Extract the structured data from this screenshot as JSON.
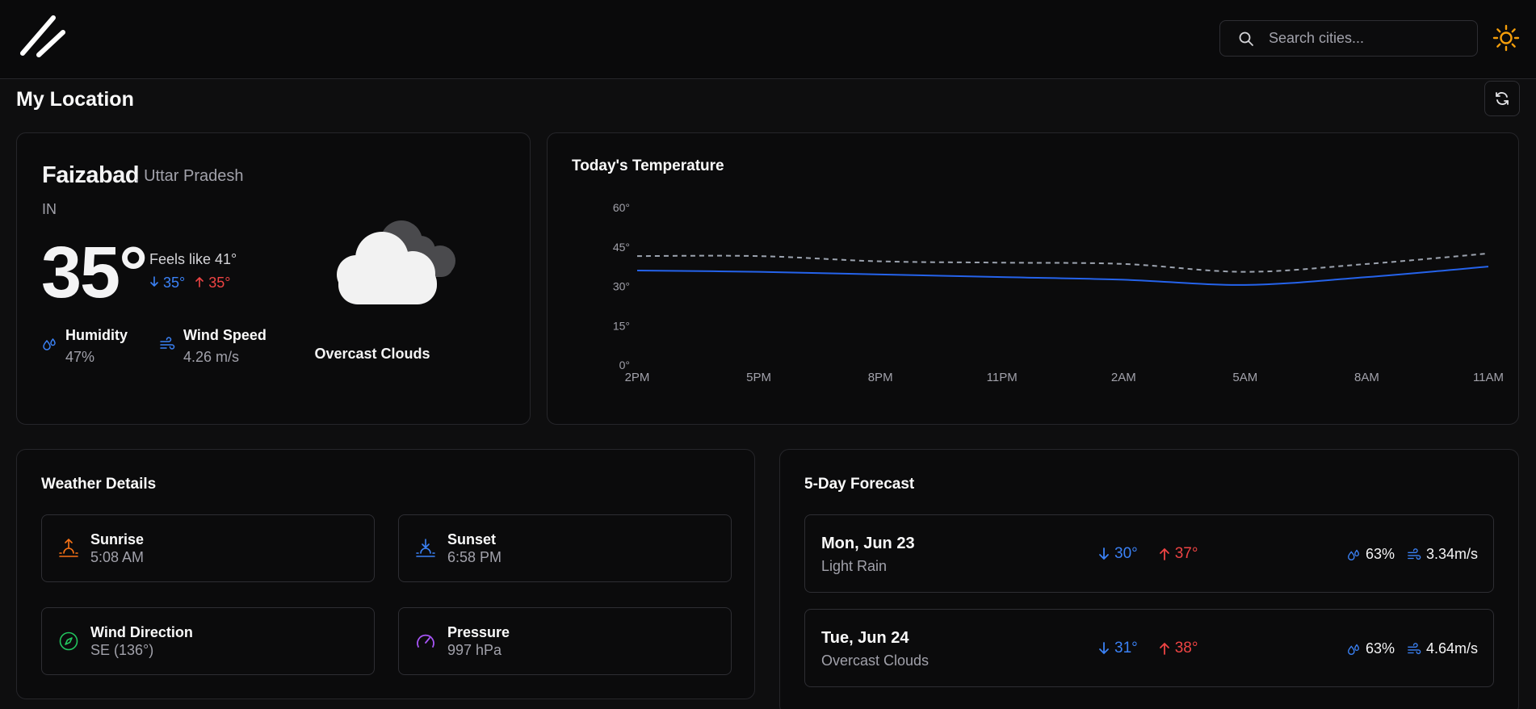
{
  "header": {
    "search_placeholder": "Search cities...",
    "accent": "#f59e0b"
  },
  "page": {
    "title": "My Location"
  },
  "current": {
    "city": "Faizabad",
    "region": ", Uttar Pradesh",
    "country": "IN",
    "temp": "35°",
    "feels_like": "Feels like 41°",
    "min": "35°",
    "max": "35°",
    "humidity_label": "Humidity",
    "humidity_value": "47%",
    "wind_label": "Wind Speed",
    "wind_value": "4.26 m/s",
    "condition": "Overcast Clouds",
    "condition_icon": "overcast-clouds-icon"
  },
  "chart": {
    "title": "Today's Temperature",
    "y_ticks": [
      "60°",
      "45°",
      "30°",
      "15°",
      "0°"
    ],
    "x_ticks": [
      "2PM",
      "5PM",
      "8PM",
      "11PM",
      "2AM",
      "5AM",
      "8AM",
      "11AM"
    ]
  },
  "chart_data": {
    "type": "line",
    "title": "Today's Temperature",
    "x": [
      "2PM",
      "5PM",
      "8PM",
      "11PM",
      "2AM",
      "5AM",
      "8AM",
      "11AM"
    ],
    "ylim": [
      0,
      60
    ],
    "grid": false,
    "series": [
      {
        "values": [
          36,
          35.5,
          34.5,
          33.5,
          32.5,
          30.5,
          33.5,
          37.5
        ],
        "color": "#2563eb",
        "style": "solid"
      },
      {
        "values": [
          41.5,
          41.5,
          39.5,
          39,
          38.5,
          35.5,
          38.5,
          42.5
        ],
        "color": "#9ca3af",
        "style": "dashed"
      }
    ]
  },
  "details": {
    "title": "Weather Details",
    "items": [
      {
        "label": "Sunrise",
        "value": "5:08 AM",
        "icon": "sunrise-icon",
        "color": "#f97316"
      },
      {
        "label": "Sunset",
        "value": "6:58 PM",
        "icon": "sunset-icon",
        "color": "#3b82f6"
      },
      {
        "label": "Wind Direction",
        "value": "SE (136°)",
        "icon": "compass-icon",
        "color": "#22c55e"
      },
      {
        "label": "Pressure",
        "value": "997 hPa",
        "icon": "gauge-icon",
        "color": "#a855f7"
      }
    ]
  },
  "forecast": {
    "title": "5-Day Forecast",
    "days": [
      {
        "day": "Mon, Jun 23",
        "desc": "Light Rain",
        "min": "30°",
        "max": "37°",
        "humidity": "63%",
        "wind": "3.34m/s"
      },
      {
        "day": "Tue, Jun 24",
        "desc": "Overcast Clouds",
        "min": "31°",
        "max": "38°",
        "humidity": "63%",
        "wind": "4.64m/s"
      }
    ]
  },
  "colors": {
    "cold": "#3b82f6",
    "hot": "#ef4444",
    "line_primary": "#2563eb",
    "line_secondary": "#9ca3af"
  }
}
